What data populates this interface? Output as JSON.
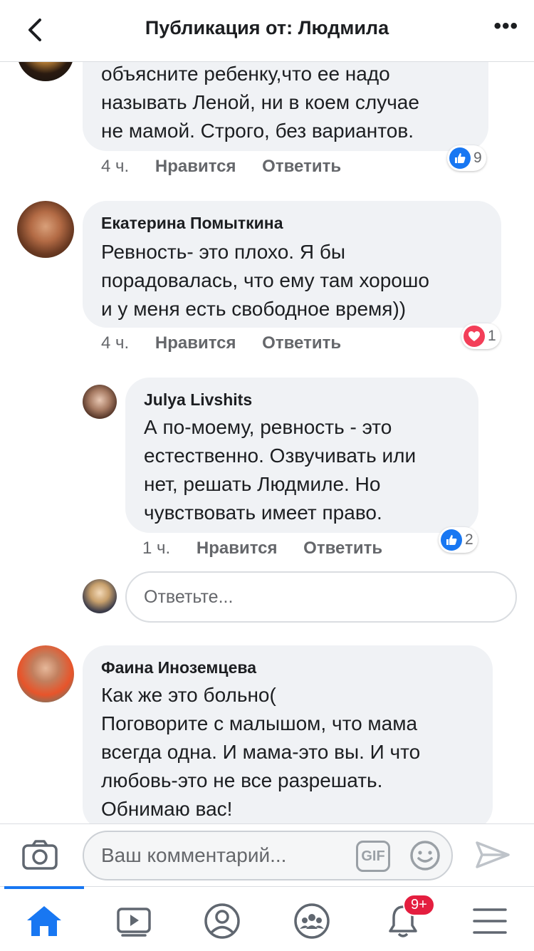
{
  "header": {
    "title": "Публикация от: Людмила",
    "more": "•••"
  },
  "comments": [
    {
      "text_lines": [
        "объясните ребенку,что ее надо",
        "называть Леной, ни в коем случае",
        "не мамой. Строго, без вариантов."
      ],
      "time": "4 ч.",
      "like": "Нравится",
      "reply": "Ответить",
      "reaction": {
        "type": "like",
        "count": "9"
      }
    },
    {
      "author": "Екатерина Помыткина",
      "text_lines": [
        "Ревность- это плохо. Я бы",
        "порадовалась, что ему там хорошо",
        "и у меня есть свободное время))"
      ],
      "time": "4 ч.",
      "like": "Нравится",
      "reply": "Ответить",
      "reaction": {
        "type": "love",
        "count": "1"
      }
    },
    {
      "author": "Julya Livshits",
      "text_lines": [
        "А по-моему, ревность - это",
        "естественно. Озвучивать или",
        "нет, решать Людмиле. Но",
        "чувствовать имеет право."
      ],
      "time": "1 ч.",
      "like": "Нравится",
      "reply": "Ответить",
      "reaction": {
        "type": "like",
        "count": "2"
      }
    },
    {
      "author": "Фаина Иноземцева",
      "text_lines": [
        "Как же это больно(",
        "Поговорите с малышом, что мама",
        "всегда одна. И мама-это вы. И что",
        "любовь-это не все разрешать.",
        "Обнимаю вас!"
      ]
    }
  ],
  "reply_placeholder": "Ответьте...",
  "composer": {
    "placeholder": "Ваш комментарий...",
    "gif": "GIF"
  },
  "tabbar": {
    "notifications_badge": "9+"
  },
  "colors": {
    "accent": "#1877f2",
    "love": "#f33e58",
    "badge": "#e41e3f"
  },
  "icons": [
    "back-arrow-icon",
    "more-icon",
    "camera-icon",
    "gif-icon",
    "emoji-icon",
    "send-icon",
    "home-icon",
    "video-icon",
    "profile-icon",
    "groups-icon",
    "bell-icon",
    "menu-icon"
  ]
}
